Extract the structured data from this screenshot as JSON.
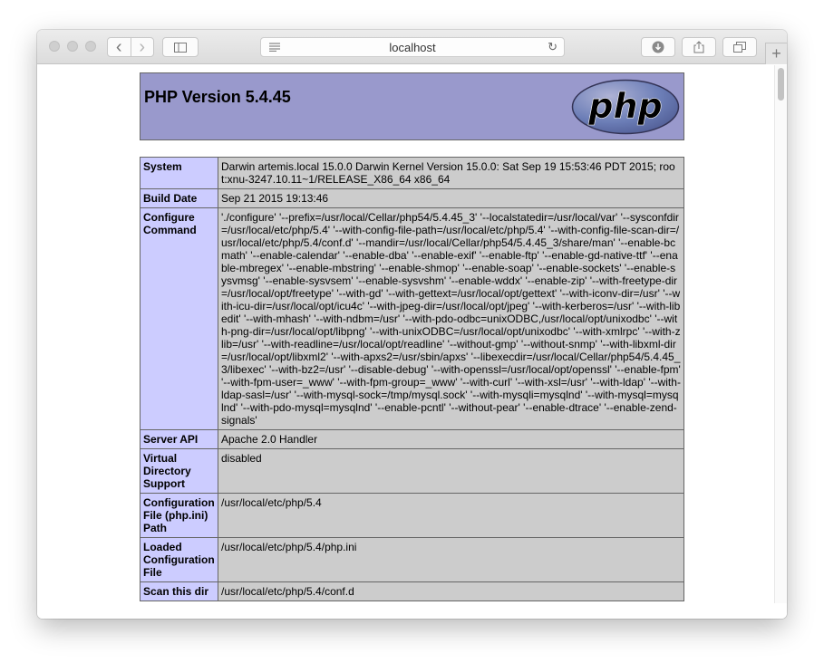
{
  "browser": {
    "url": "localhost",
    "reload_icon": "↻",
    "back_icon": "‹",
    "forward_icon": "›",
    "new_tab_icon": "+"
  },
  "page": {
    "title": "PHP Version 5.4.45",
    "logo_text": "php"
  },
  "rows": [
    {
      "label": "System",
      "value": "Darwin artemis.local 15.0.0 Darwin Kernel Version 15.0.0: Sat Sep 19 15:53:46 PDT 2015; root:xnu-3247.10.11~1/RELEASE_X86_64 x86_64"
    },
    {
      "label": "Build Date",
      "value": "Sep 21 2015 19:13:46"
    },
    {
      "label": "Configure Command",
      "value": "'./configure' '--prefix=/usr/local/Cellar/php54/5.4.45_3' '--localstatedir=/usr/local/var' '--sysconfdir=/usr/local/etc/php/5.4' '--with-config-file-path=/usr/local/etc/php/5.4' '--with-config-file-scan-dir=/usr/local/etc/php/5.4/conf.d' '--mandir=/usr/local/Cellar/php54/5.4.45_3/share/man' '--enable-bcmath' '--enable-calendar' '--enable-dba' '--enable-exif' '--enable-ftp' '--enable-gd-native-ttf' '--enable-mbregex' '--enable-mbstring' '--enable-shmop' '--enable-soap' '--enable-sockets' '--enable-sysvmsg' '--enable-sysvsem' '--enable-sysvshm' '--enable-wddx' '--enable-zip' '--with-freetype-dir=/usr/local/opt/freetype' '--with-gd' '--with-gettext=/usr/local/opt/gettext' '--with-iconv-dir=/usr' '--with-icu-dir=/usr/local/opt/icu4c' '--with-jpeg-dir=/usr/local/opt/jpeg' '--with-kerberos=/usr' '--with-libedit' '--with-mhash' '--with-ndbm=/usr' '--with-pdo-odbc=unixODBC,/usr/local/opt/unixodbc' '--with-png-dir=/usr/local/opt/libpng' '--with-unixODBC=/usr/local/opt/unixodbc' '--with-xmlrpc' '--with-zlib=/usr' '--with-readline=/usr/local/opt/readline' '--without-gmp' '--without-snmp' '--with-libxml-dir=/usr/local/opt/libxml2' '--with-apxs2=/usr/sbin/apxs' '--libexecdir=/usr/local/Cellar/php54/5.4.45_3/libexec' '--with-bz2=/usr' '--disable-debug' '--with-openssl=/usr/local/opt/openssl' '--enable-fpm' '--with-fpm-user=_www' '--with-fpm-group=_www' '--with-curl' '--with-xsl=/usr' '--with-ldap' '--with-ldap-sasl=/usr' '--with-mysql-sock=/tmp/mysql.sock' '--with-mysqli=mysqlnd' '--with-mysql=mysqlnd' '--with-pdo-mysql=mysqlnd' '--enable-pcntl' '--without-pear' '--enable-dtrace' '--enable-zend-signals'"
    },
    {
      "label": "Server API",
      "value": "Apache 2.0 Handler"
    },
    {
      "label": "Virtual Directory Support",
      "value": "disabled"
    },
    {
      "label": "Configuration File (php.ini) Path",
      "value": "/usr/local/etc/php/5.4"
    },
    {
      "label": "Loaded Configuration File",
      "value": "/usr/local/etc/php/5.4/php.ini"
    },
    {
      "label": "Scan this dir",
      "value": "/usr/local/etc/php/5.4/conf.d"
    }
  ],
  "colors": {
    "header_bg": "#9999cc",
    "label_bg": "#ccccff",
    "value_bg": "#cccccc",
    "border": "#666666"
  }
}
